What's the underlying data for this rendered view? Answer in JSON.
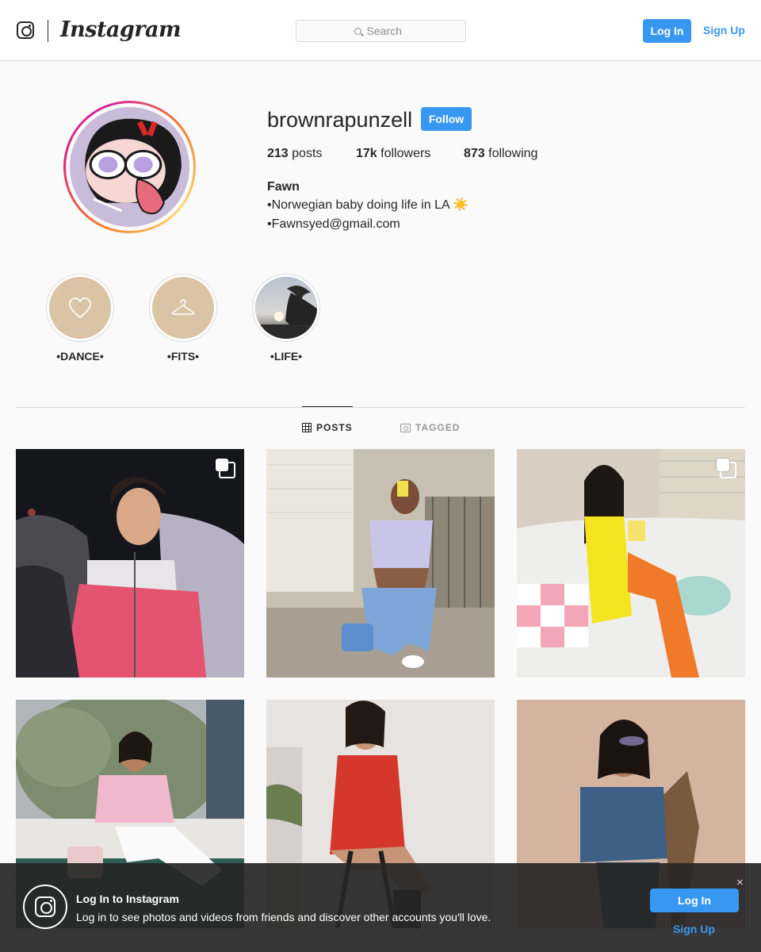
{
  "header": {
    "brand": "Instagram",
    "search_placeholder": "Search",
    "login_label": "Log In",
    "signup_label": "Sign Up"
  },
  "profile": {
    "username": "brownrapunzell",
    "follow_label": "Follow",
    "stats": {
      "posts_count": "213",
      "posts_label": "posts",
      "followers_count": "17k",
      "followers_label": "followers",
      "following_count": "873",
      "following_label": "following"
    },
    "full_name": "Fawn",
    "bio_line1": "•Norwegian baby doing life in LA",
    "bio_emoji": "☀️",
    "bio_line2": "•Fawnsyed@gmail.com"
  },
  "highlights": [
    {
      "label": "•DANCE•",
      "icon": "heart-icon"
    },
    {
      "label": "•FITS•",
      "icon": "hanger-icon"
    },
    {
      "label": "•LIFE•",
      "icon": "palm-tree-photo"
    }
  ],
  "tabs": [
    {
      "label": "POSTS",
      "active": true
    },
    {
      "label": "TAGGED",
      "active": false
    }
  ],
  "posts": [
    {
      "multiple": true
    },
    {
      "multiple": false
    },
    {
      "multiple": true
    },
    {
      "multiple": false
    },
    {
      "multiple": false
    },
    {
      "multiple": false
    }
  ],
  "login_banner": {
    "title": "Log In to Instagram",
    "text": "Log in to see photos and videos from friends and discover other accounts you'll love.",
    "close": "×",
    "login_label": "Log In",
    "signup_label": "Sign Up"
  },
  "colors": {
    "accent": "#3897f0",
    "highlight_bg": "#dbc4a6",
    "banner_bg": "#262626"
  }
}
